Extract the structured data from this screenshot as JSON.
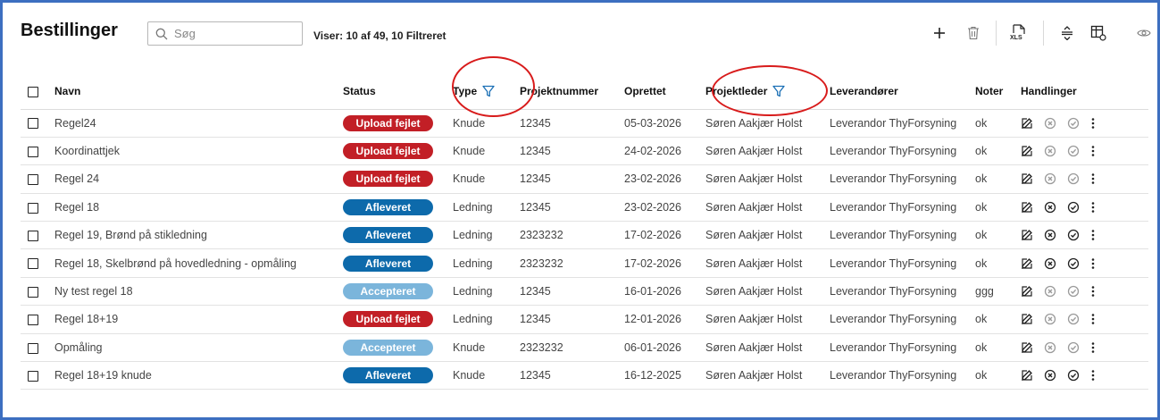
{
  "header": {
    "title": "Bestillinger",
    "search_placeholder": "Søg",
    "count_text": "Viser: 10 af 49, 10 Filtreret"
  },
  "toolbar": {
    "icons": [
      "plus-icon",
      "trash-icon",
      "xls-export-icon",
      "expand-rows-icon",
      "table-settings-icon",
      "eye-icon"
    ],
    "xls_label": "XLS"
  },
  "columns": {
    "name": "Navn",
    "status": "Status",
    "type": "Type",
    "project_number": "Projektnummer",
    "created": "Oprettet",
    "project_lead": "Projektleder",
    "suppliers": "Leverandører",
    "notes": "Noter",
    "actions": "Handlinger"
  },
  "status_colors": {
    "Upload fejlet": "#c21f26",
    "Afleveret": "#0d6aab",
    "Accepteret": "#7bb5db"
  },
  "rows": [
    {
      "name": "Regel24",
      "status": "Upload fejlet",
      "type": "Knude",
      "project_number": "12345",
      "created": "05-03-2026",
      "project_lead": "Søren Aakjær Holst",
      "supplier": "Leverandor ThyForsyning",
      "notes": "ok",
      "actions_enabled": false
    },
    {
      "name": "Koordinattjek",
      "status": "Upload fejlet",
      "type": "Knude",
      "project_number": "12345",
      "created": "24-02-2026",
      "project_lead": "Søren Aakjær Holst",
      "supplier": "Leverandor ThyForsyning",
      "notes": "ok",
      "actions_enabled": false
    },
    {
      "name": "Regel 24",
      "status": "Upload fejlet",
      "type": "Knude",
      "project_number": "12345",
      "created": "23-02-2026",
      "project_lead": "Søren Aakjær Holst",
      "supplier": "Leverandor ThyForsyning",
      "notes": "ok",
      "actions_enabled": false
    },
    {
      "name": "Regel 18",
      "status": "Afleveret",
      "type": "Ledning",
      "project_number": "12345",
      "created": "23-02-2026",
      "project_lead": "Søren Aakjær Holst",
      "supplier": "Leverandor ThyForsyning",
      "notes": "ok",
      "actions_enabled": true
    },
    {
      "name": "Regel 19, Brønd på stikledning",
      "status": "Afleveret",
      "type": "Ledning",
      "project_number": "2323232",
      "created": "17-02-2026",
      "project_lead": "Søren Aakjær Holst",
      "supplier": "Leverandor ThyForsyning",
      "notes": "ok",
      "actions_enabled": true
    },
    {
      "name": "Regel 18, Skelbrønd på hovedledning - opmåling",
      "status": "Afleveret",
      "type": "Ledning",
      "project_number": "2323232",
      "created": "17-02-2026",
      "project_lead": "Søren Aakjær Holst",
      "supplier": "Leverandor ThyForsyning",
      "notes": "ok",
      "actions_enabled": true
    },
    {
      "name": "Ny test regel 18",
      "status": "Accepteret",
      "type": "Ledning",
      "project_number": "12345",
      "created": "16-01-2026",
      "project_lead": "Søren Aakjær Holst",
      "supplier": "Leverandor ThyForsyning",
      "notes": "ggg",
      "actions_enabled": false
    },
    {
      "name": "Regel 18+19",
      "status": "Upload fejlet",
      "type": "Ledning",
      "project_number": "12345",
      "created": "12-01-2026",
      "project_lead": "Søren Aakjær Holst",
      "supplier": "Leverandor ThyForsyning",
      "notes": "ok",
      "actions_enabled": false
    },
    {
      "name": "Opmåling",
      "status": "Accepteret",
      "type": "Knude",
      "project_number": "2323232",
      "created": "06-01-2026",
      "project_lead": "Søren Aakjær Holst",
      "supplier": "Leverandor ThyForsyning",
      "notes": "ok",
      "actions_enabled": false
    },
    {
      "name": "Regel 18+19 knude",
      "status": "Afleveret",
      "type": "Knude",
      "project_number": "12345",
      "created": "16-12-2025",
      "project_lead": "Søren Aakjær Holst",
      "supplier": "Leverandor ThyForsyning",
      "notes": "ok",
      "actions_enabled": true
    }
  ],
  "row_action_icons": [
    "edit-icon",
    "cancel-circle-icon",
    "check-circle-icon",
    "more-vertical-icon"
  ]
}
